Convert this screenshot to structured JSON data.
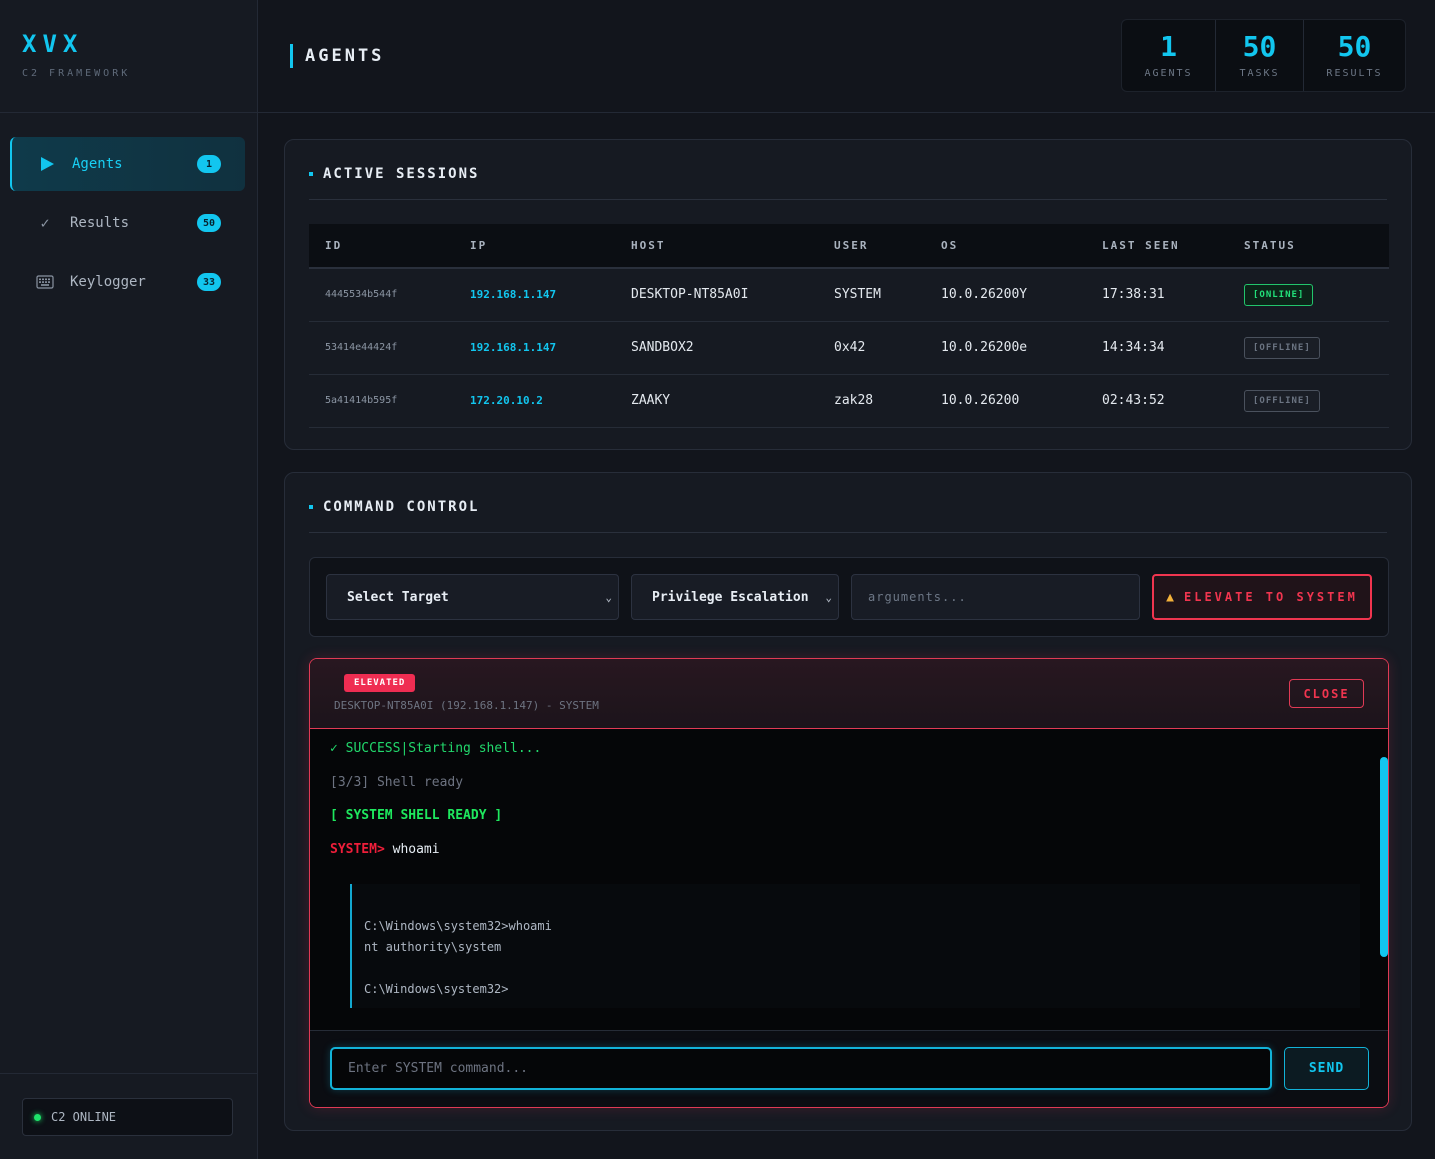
{
  "brand": {
    "title": "XVX",
    "subtitle": "C2 FRAMEWORK"
  },
  "sidebar": {
    "items": [
      {
        "label": "Agents",
        "badge": "1",
        "icon": "play-icon",
        "active": true
      },
      {
        "label": "Results",
        "badge": "50",
        "icon": "check-icon",
        "active": false
      },
      {
        "label": "Keylogger",
        "badge": "33",
        "icon": "keyboard-icon",
        "active": false
      }
    ],
    "status": "C2 ONLINE"
  },
  "header": {
    "title": "AGENTS",
    "stats": [
      {
        "value": "1",
        "label": "AGENTS"
      },
      {
        "value": "50",
        "label": "TASKS"
      },
      {
        "value": "50",
        "label": "RESULTS"
      }
    ]
  },
  "sessions": {
    "title": "ACTIVE SESSIONS",
    "columns": [
      "ID",
      "IP",
      "HOST",
      "USER",
      "OS",
      "LAST SEEN",
      "STATUS"
    ],
    "rows": [
      {
        "id": "4445534b544f",
        "ip": "192.168.1.147",
        "host": "DESKTOP-NT85A0I",
        "user": "SYSTEM",
        "os": "10.0.26200Y",
        "last_seen": "17:38:31",
        "status": "[ONLINE]"
      },
      {
        "id": "53414e44424f",
        "ip": "192.168.1.147",
        "host": "SANDBOX2",
        "user": "0x42",
        "os": "10.0.26200e",
        "last_seen": "14:34:34",
        "status": "[OFFLINE]"
      },
      {
        "id": "5a41414b595f",
        "ip": "172.20.10.2",
        "host": "ZAAKY",
        "user": "zak28",
        "os": "10.0.26200",
        "last_seen": "02:43:52",
        "status": "[OFFLINE]"
      }
    ]
  },
  "command": {
    "title": "COMMAND CONTROL",
    "target_select": "Select Target",
    "module_select": "Privilege Escalation",
    "args_placeholder": "arguments...",
    "elevate_label": "ELEVATE TO SYSTEM"
  },
  "shell": {
    "badge": "ELEVATED",
    "subtitle": "DESKTOP-NT85A0I (192.168.1.147) - SYSTEM",
    "close_label": "CLOSE",
    "lines": {
      "success": "✓ SUCCESS|Starting shell...",
      "step": "[3/3] Shell ready",
      "ready": "[ SYSTEM SHELL READY ]",
      "prompt": "SYSTEM>",
      "command": "whoami"
    },
    "output": "C:\\Windows\\system32>whoami\nnt authority\\system\n\nC:\\Windows\\system32>",
    "input_placeholder": "Enter SYSTEM command...",
    "send_label": "SEND"
  },
  "colors": {
    "accent": "#12c6ef",
    "danger": "#f0354f",
    "online": "#22e07a"
  }
}
